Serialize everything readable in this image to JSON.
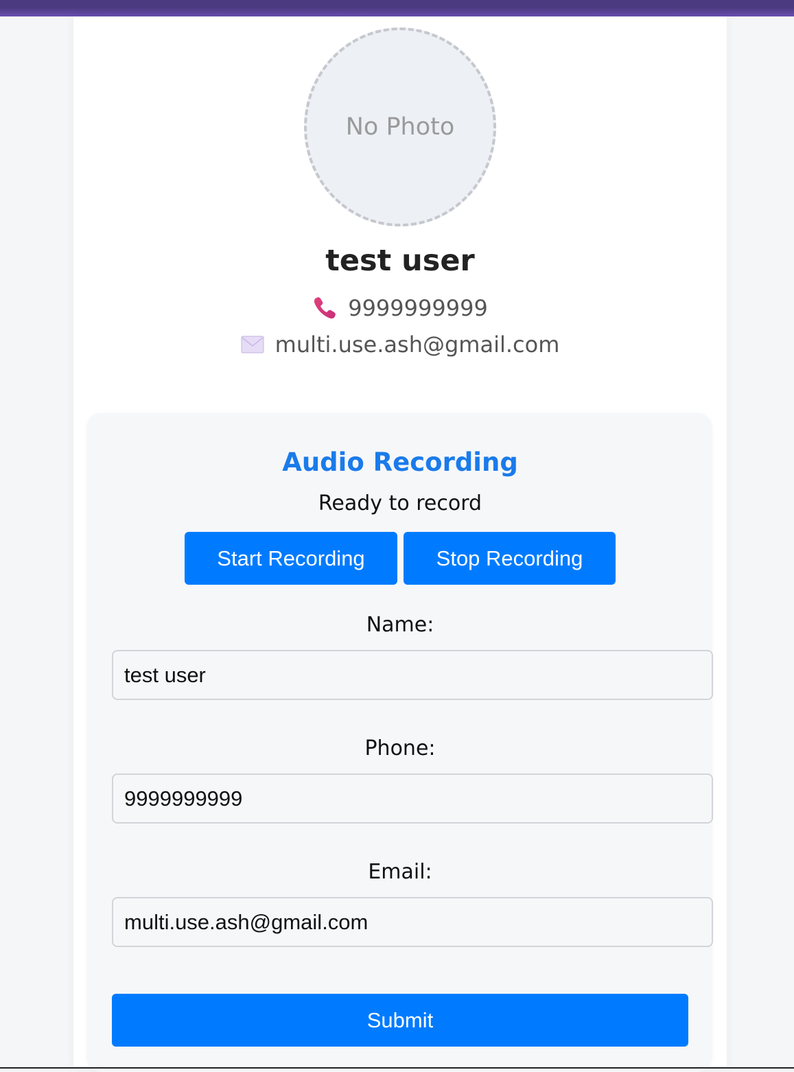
{
  "profile": {
    "photo_placeholder": "No Photo",
    "name": "test user",
    "phone": "9999999999",
    "email": "multi.use.ash@gmail.com",
    "phone_icon": "telephone-receiver-icon",
    "email_icon": "envelope-icon"
  },
  "recording": {
    "title": "Audio Recording",
    "status": "Ready to record",
    "start_label": "Start Recording",
    "stop_label": "Stop Recording"
  },
  "form": {
    "name_label": "Name:",
    "name_value": "test user",
    "phone_label": "Phone:",
    "phone_value": "9999999999",
    "email_label": "Email:",
    "email_value": "multi.use.ash@gmail.com",
    "submit_label": "Submit"
  },
  "colors": {
    "accent": "#007bff",
    "title": "#1a7bea",
    "header_bar": "#4b3a80"
  }
}
